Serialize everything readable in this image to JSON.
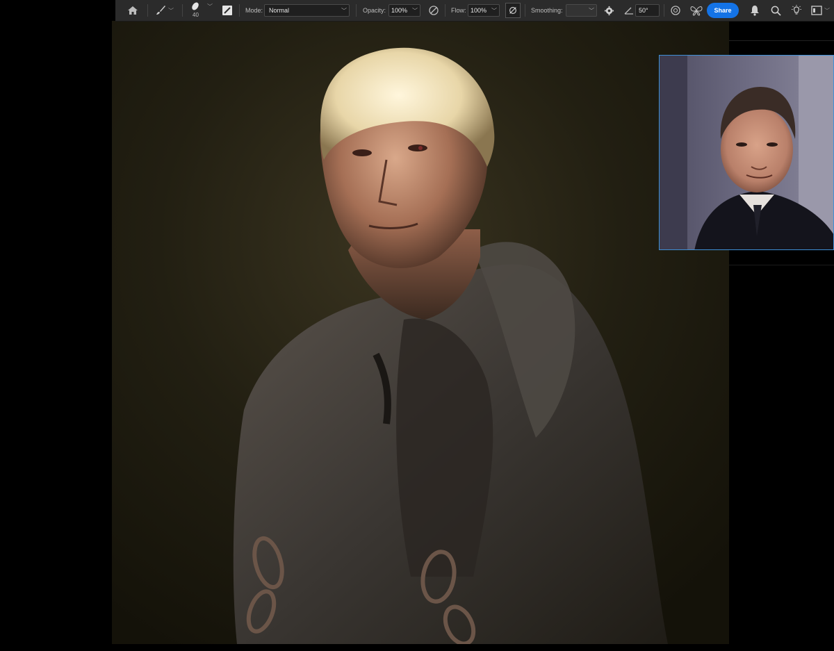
{
  "toolbar": {
    "brush_size": "40",
    "mode_label": "Mode:",
    "mode_value": "Normal",
    "opacity_label": "Opacity:",
    "opacity_value": "100%",
    "flow_label": "Flow:",
    "flow_value": "100%",
    "smoothing_label": "Smoothing:",
    "smoothing_value": "",
    "angle_value": "50°",
    "share_label": "Share"
  },
  "icons": {
    "home": "home-icon",
    "brush": "brush-icon",
    "brush_preset": "brush-tip-icon",
    "brush_panel": "brush-settings-icon",
    "pressure_opacity": "pressure-opacity-icon",
    "airbrush": "airbrush-icon",
    "gear": "gear-icon",
    "angle": "angle-icon",
    "pressure_size": "pressure-size-icon",
    "symmetry": "butterfly-symmetry-icon",
    "bell": "bell-icon",
    "search": "search-icon",
    "discover": "lightbulb-icon",
    "workspace": "workspace-icon"
  },
  "colors": {
    "accent": "#1473e6",
    "toolbar_bg": "#2b2b2b",
    "canvas_bg": "#1c1a10",
    "selection_border": "#3e8fd6"
  }
}
